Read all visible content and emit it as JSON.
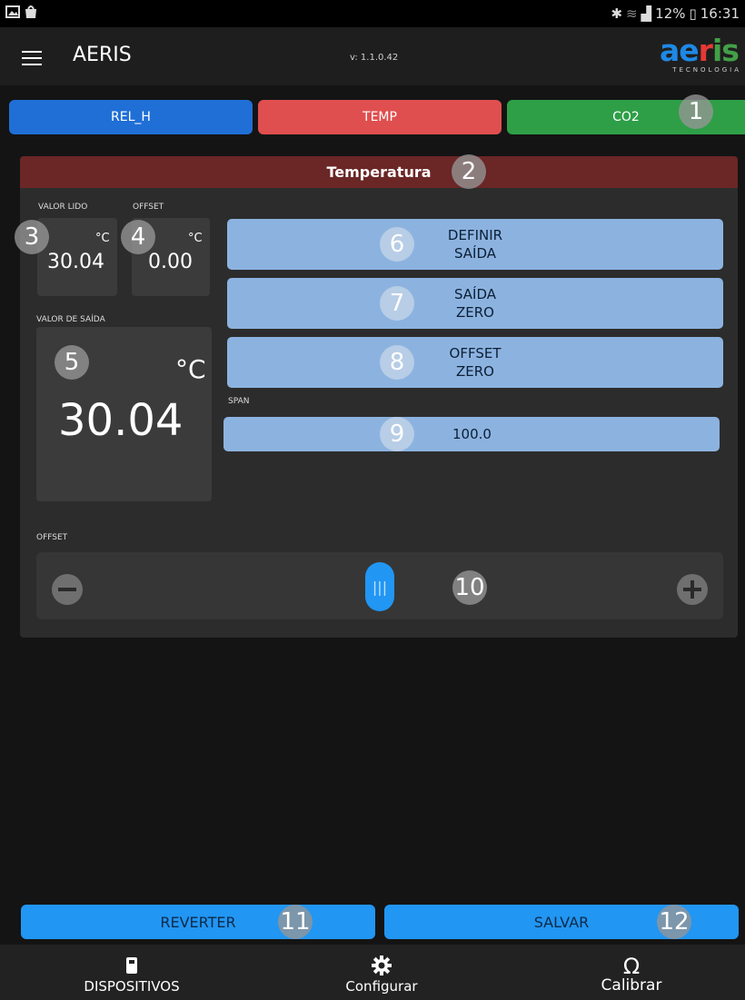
{
  "status_bar": {
    "battery_percent": "12%",
    "time": "16:31"
  },
  "app_bar": {
    "title": "AERIS",
    "version": "v: 1.1.0.42",
    "logo_text": "aeris",
    "logo_sub": "TECNOLOGIA"
  },
  "tabs": [
    {
      "label": "REL_H",
      "color": "#1f6fd6"
    },
    {
      "label": "TEMP",
      "color": "#e04f4f"
    },
    {
      "label": "CO2",
      "color": "#2e9f47"
    }
  ],
  "panel": {
    "title": "Temperatura",
    "valor_lido_label": "VALOR LIDO",
    "valor_lido_unit": "°C",
    "valor_lido": "30.04",
    "offset_label": "OFFSET",
    "offset_unit": "°C",
    "offset_value": "0.00",
    "valor_saida_label": "VALOR DE SAÍDA",
    "valor_saida_unit": "°C",
    "valor_saida": "30.04",
    "definir_saida": [
      "DEFINIR",
      "SAÍDA"
    ],
    "saida_zero": [
      "SAÍDA",
      "ZERO"
    ],
    "offset_zero": [
      "OFFSET",
      "ZERO"
    ],
    "span_label": "SPAN",
    "span_value": "100.0",
    "offset_slider_label": "OFFSET"
  },
  "badges": [
    "1",
    "2",
    "3",
    "4",
    "5",
    "6",
    "7",
    "8",
    "9",
    "10",
    "11",
    "12"
  ],
  "actions": {
    "revert": "REVERTER",
    "save": "SALVAR"
  },
  "bottom_nav": [
    {
      "label": "DISPOSITIVOS",
      "icon": "device-icon"
    },
    {
      "label": "Configurar",
      "icon": "gear-icon"
    },
    {
      "label": "Calibrar",
      "icon": "omega-icon"
    }
  ],
  "colors": {
    "accent": "#2196f3",
    "panel_header": "#6b2626",
    "button_blue": "#8cb3e0"
  }
}
